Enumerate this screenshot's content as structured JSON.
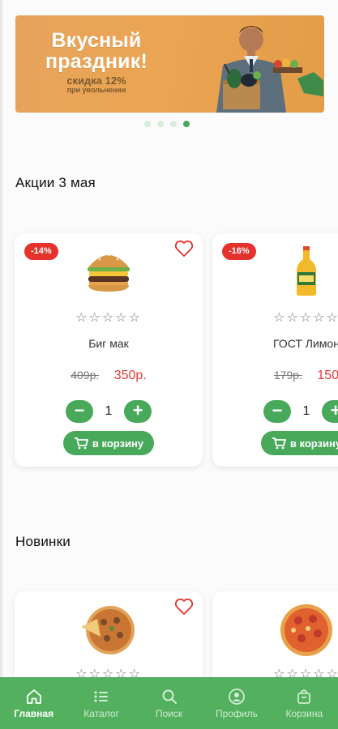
{
  "banner": {
    "title_line1": "Вкусный",
    "title_line2": "праздник!",
    "subtitle": "скидка 12%",
    "note": "при увольнении"
  },
  "carousel": {
    "count": 4,
    "active_index": 3
  },
  "sections": {
    "promo_title": "Акции 3 мая",
    "new_title": "Новинки"
  },
  "promo_products": [
    {
      "discount": "-14%",
      "name": "Биг мак",
      "old_price": "409р.",
      "price": "350р.",
      "quantity": "1",
      "cart_label": "в корзину",
      "rating": 0,
      "image_icon": "burger-icon"
    },
    {
      "discount": "-16%",
      "name": "ГОСТ Лимон",
      "old_price": "179р.",
      "price": "150",
      "quantity": "1",
      "cart_label": "в корзину",
      "rating": 0,
      "image_icon": "lemonade-bottle-icon"
    }
  ],
  "new_products": [
    {
      "name": "",
      "image_icon": "pizza-icon"
    },
    {
      "name": "",
      "image_icon": "pizza-icon"
    }
  ],
  "bottom_nav": [
    {
      "label": "Главная",
      "icon": "home-icon",
      "active": true
    },
    {
      "label": "Каталог",
      "icon": "list-icon",
      "active": false
    },
    {
      "label": "Поиск",
      "icon": "search-icon",
      "active": false
    },
    {
      "label": "Профиль",
      "icon": "profile-icon",
      "active": false
    },
    {
      "label": "Корзина",
      "icon": "bag-icon",
      "active": false
    }
  ],
  "colors": {
    "accent": "#49a95b",
    "nav_bg": "#52b05e",
    "badge": "#e5322d",
    "price": "#e03b35",
    "banner_bg": "#eba553"
  }
}
